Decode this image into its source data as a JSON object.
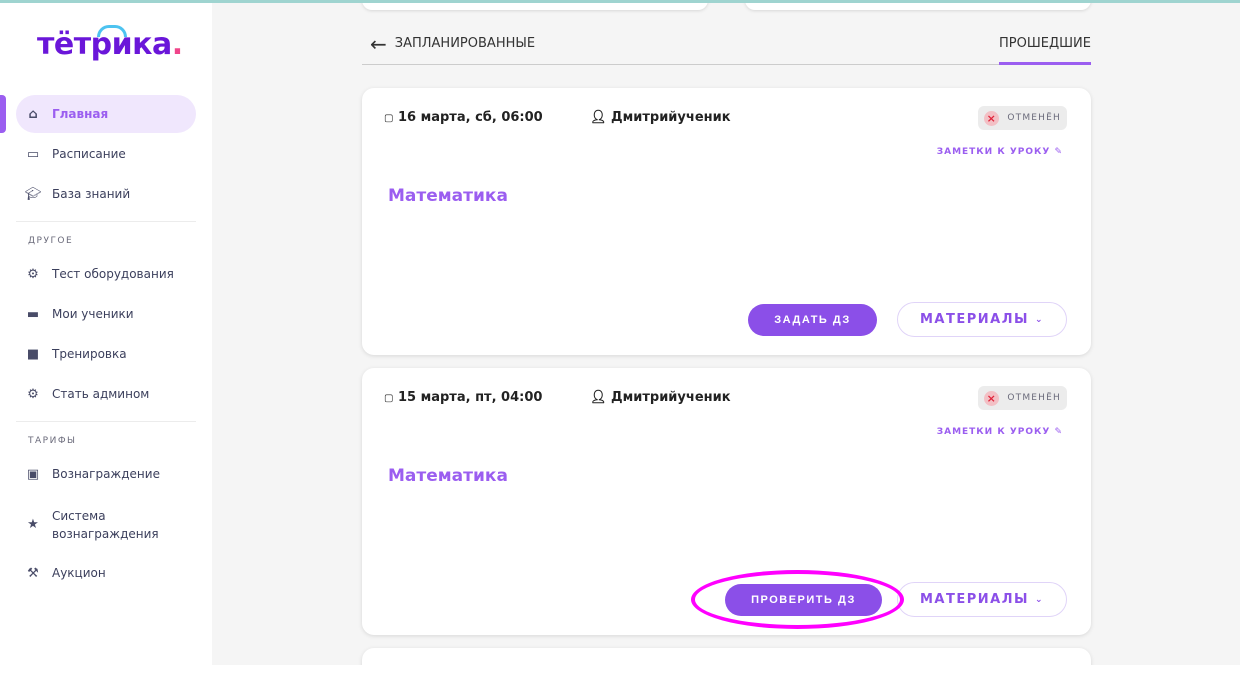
{
  "logo": {
    "text": "тётрика",
    "dot": "."
  },
  "sidebar": {
    "items": [
      {
        "label": "Главная",
        "icon": "home-icon"
      },
      {
        "label": "Расписание",
        "icon": "calendar-icon"
      },
      {
        "label": "База знаний",
        "icon": "graduation-cap-icon"
      }
    ],
    "other_title": "ДРУГОЕ",
    "other": [
      {
        "label": "Тест оборудования",
        "icon": "gear-icon"
      },
      {
        "label": "Мои ученики",
        "icon": "folder-icon"
      },
      {
        "label": "Тренировка",
        "icon": "box-icon"
      },
      {
        "label": "Стать админом",
        "icon": "gear-icon"
      }
    ],
    "tariffs_title": "ТАРИФЫ",
    "tariffs": [
      {
        "label": "Вознаграждение",
        "icon": "money-icon"
      },
      {
        "label": "Система вознаграждения",
        "icon": "star-icon"
      },
      {
        "label": "Аукцион",
        "icon": "gavel-icon"
      }
    ]
  },
  "tabs": {
    "scheduled": "ЗАПЛАНИРОВАННЫЕ",
    "past": "ПРОШЕДШИЕ"
  },
  "lessons": [
    {
      "date": "16 марта, сб, 06:00",
      "student": "Дмитрийученик",
      "status": "ОТМЕНЁН",
      "notes": "ЗАМЕТКИ К УРОКУ",
      "subject": "Математика",
      "action": "ЗАДАТЬ ДЗ",
      "materials": "МАТЕРИАЛЫ"
    },
    {
      "date": "15 марта, пт, 04:00",
      "student": "Дмитрийученик",
      "status": "ОТМЕНЁН",
      "notes": "ЗАМЕТКИ К УРОКУ",
      "subject": "Математика",
      "action": "ПРОВЕРИТЬ ДЗ",
      "materials": "МАТЕРИАЛЫ"
    }
  ]
}
